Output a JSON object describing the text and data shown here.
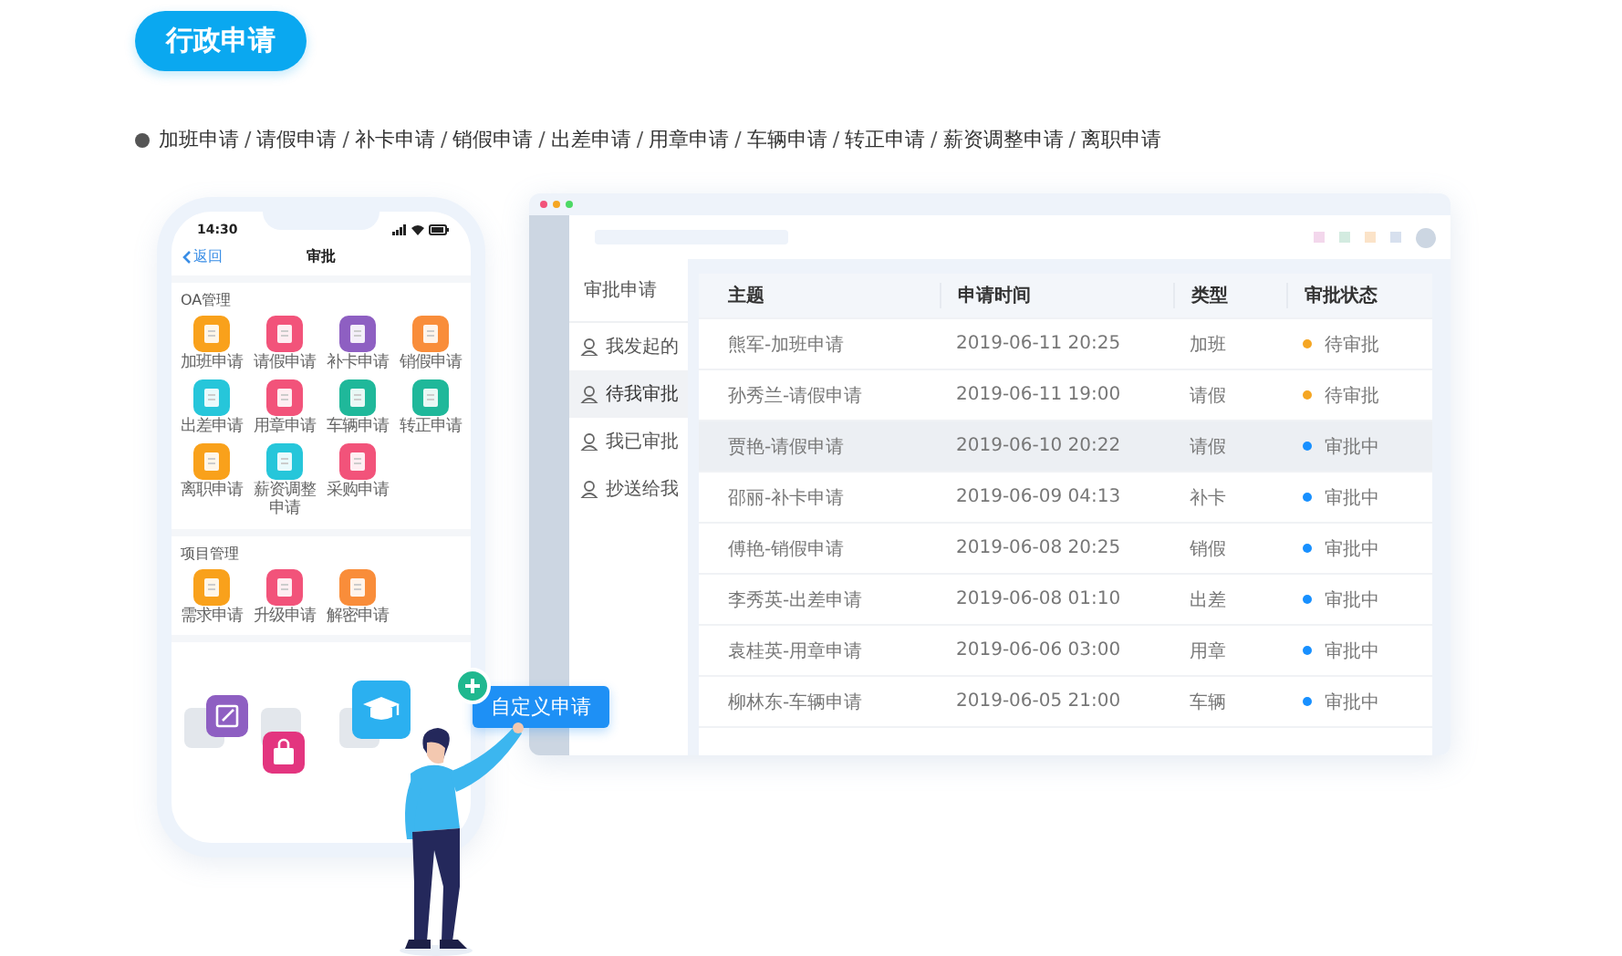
{
  "title_badge": "行政申请",
  "category_separator": "/",
  "categories": [
    "加班申请",
    "请假申请",
    "补卡申请",
    "销假申请",
    "出差申请",
    "用章申请",
    "车辆申请",
    "转正申请",
    "薪资调整申请",
    "离职申请"
  ],
  "phone": {
    "time": "14:30",
    "back": "返回",
    "title": "审批",
    "sections": [
      {
        "title": "OA管理",
        "apps": [
          {
            "label": "加班申请",
            "color": "#f9a11b"
          },
          {
            "label": "请假申请",
            "color": "#f2537a"
          },
          {
            "label": "补卡申请",
            "color": "#8e5fc2"
          },
          {
            "label": "销假申请",
            "color": "#f98d3a"
          },
          {
            "label": "出差申请",
            "color": "#26c6da"
          },
          {
            "label": "用章申请",
            "color": "#f2537a"
          },
          {
            "label": "车辆申请",
            "color": "#1fb89a"
          },
          {
            "label": "转正申请",
            "color": "#1fb89a"
          },
          {
            "label": "离职申请",
            "color": "#f9a11b"
          },
          {
            "label": "薪资调整申请",
            "color": "#26c6da"
          },
          {
            "label": "采购申请",
            "color": "#f2537a"
          }
        ]
      },
      {
        "title": "项目管理",
        "apps": [
          {
            "label": "需求申请",
            "color": "#f9a11b"
          },
          {
            "label": "升级申请",
            "color": "#f2537a"
          },
          {
            "label": "解密申请",
            "color": "#f98d3a"
          }
        ]
      }
    ]
  },
  "desktop": {
    "sidebar": {
      "title": "审批申请",
      "items": [
        {
          "label": "我发起的",
          "selected": false
        },
        {
          "label": "待我审批",
          "selected": true
        },
        {
          "label": "我已审批",
          "selected": false
        },
        {
          "label": "抄送给我",
          "selected": false
        }
      ]
    },
    "table": {
      "columns": [
        "主题",
        "申请时间",
        "类型",
        "审批状态"
      ],
      "rows": [
        {
          "subject": "熊军-加班申请",
          "time": "2019-06-11   20:25",
          "type": "加班",
          "status": "待审批",
          "color": "#f5a623",
          "selected": false
        },
        {
          "subject": "孙秀兰-请假申请",
          "time": "2019-06-11   19:00",
          "type": "请假",
          "status": "待审批",
          "color": "#f5a623",
          "selected": false
        },
        {
          "subject": "贾艳-请假申请",
          "time": "2019-06-10  20:22",
          "type": "请假",
          "status": "审批中",
          "color": "#1890ff",
          "selected": true
        },
        {
          "subject": "邵丽-补卡申请",
          "time": "2019-06-09 04:13",
          "type": "补卡",
          "status": "审批中",
          "color": "#1890ff",
          "selected": false
        },
        {
          "subject": "傅艳-销假申请",
          "time": "2019-06-08 20:25",
          "type": "销假",
          "status": "审批中",
          "color": "#1890ff",
          "selected": false
        },
        {
          "subject": "李秀英-出差申请",
          "time": "2019-06-08 01:10",
          "type": "出差",
          "status": "审批中",
          "color": "#1890ff",
          "selected": false
        },
        {
          "subject": "袁桂英-用章申请",
          "time": "2019-06-06 03:00",
          "type": "用章",
          "status": "审批中",
          "color": "#1890ff",
          "selected": false
        },
        {
          "subject": "柳林东-车辆申请",
          "time": "2019-06-05 21:00",
          "type": "车辆",
          "status": "审批中",
          "color": "#1890ff",
          "selected": false
        }
      ]
    }
  },
  "custom_button": "自定义申请"
}
